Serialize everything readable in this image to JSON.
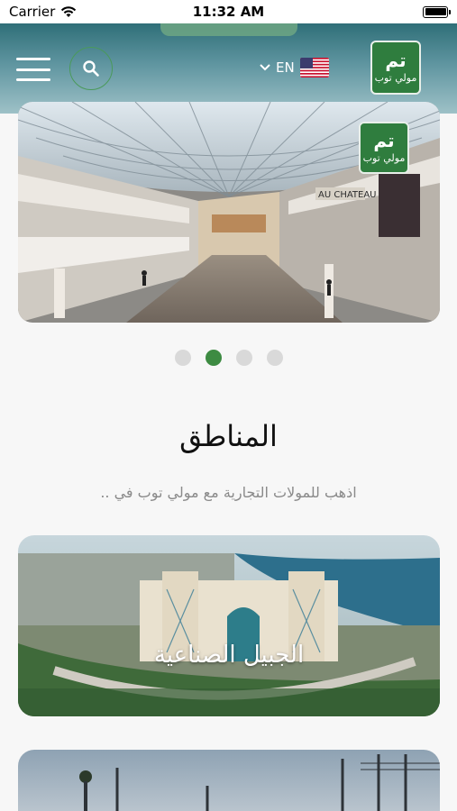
{
  "status_bar": {
    "carrier": "Carrier",
    "time": "11:32 AM"
  },
  "header": {
    "language": "EN",
    "logo_mark": "تم",
    "logo_text": "مولي توب"
  },
  "slider": {
    "store_sign": "AU CHATEAU",
    "dots_count": 4,
    "active_index": 1
  },
  "section": {
    "title": "المناطق",
    "subtitle": "اذهب للمولات التجارية مع مولي توب في .."
  },
  "areas": [
    {
      "name": "الجبيل الصناعية"
    },
    {
      "name": ""
    }
  ],
  "colors": {
    "accent": "#3d8b42",
    "header": "#2f6f78"
  }
}
